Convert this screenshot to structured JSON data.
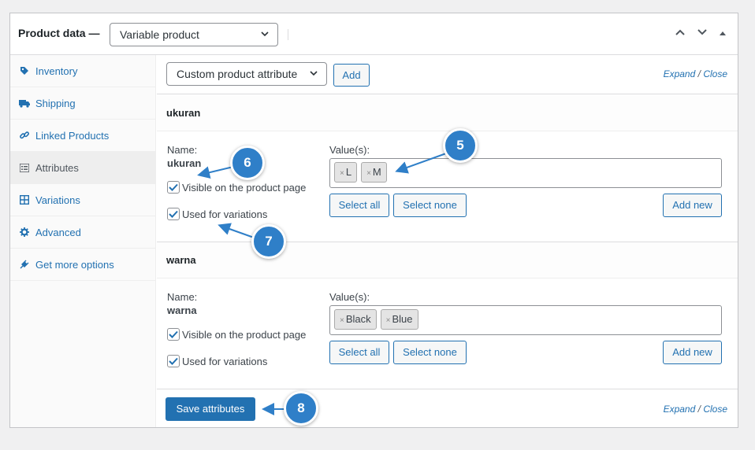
{
  "header": {
    "title": "Product data —",
    "product_type": "Variable product"
  },
  "sidebar": {
    "items": [
      {
        "label": "Inventory",
        "icon": "tag-icon"
      },
      {
        "label": "Shipping",
        "icon": "truck-icon"
      },
      {
        "label": "Linked Products",
        "icon": "link-icon"
      },
      {
        "label": "Attributes",
        "icon": "list-icon"
      },
      {
        "label": "Variations",
        "icon": "grid-icon"
      },
      {
        "label": "Advanced",
        "icon": "gear-icon"
      },
      {
        "label": "Get more options",
        "icon": "plugin-icon"
      }
    ]
  },
  "toolbar": {
    "attribute_select": "Custom product attribute",
    "add_label": "Add",
    "expand": "Expand",
    "slash": "/",
    "close": "Close"
  },
  "attributes": [
    {
      "title": "ukuran",
      "name_label": "Name:",
      "name_value": "ukuran",
      "values_label": "Value(s):",
      "chips": [
        "L",
        "M"
      ],
      "visible_label": "Visible on the product page",
      "variations_label": "Used for variations",
      "select_all": "Select all",
      "select_none": "Select none",
      "add_new": "Add new"
    },
    {
      "title": "warna",
      "name_label": "Name:",
      "name_value": "warna",
      "values_label": "Value(s):",
      "chips": [
        "Black",
        "Blue"
      ],
      "visible_label": "Visible on the product page",
      "variations_label": "Used for variations",
      "select_all": "Select all",
      "select_none": "Select none",
      "add_new": "Add new"
    }
  ],
  "footer": {
    "save_label": "Save attributes",
    "expand": "Expand",
    "slash": "/",
    "close": "Close"
  },
  "callouts": [
    "5",
    "6",
    "7",
    "8"
  ],
  "colors": {
    "accent": "#2271b1",
    "callout": "#2f7fc8"
  }
}
